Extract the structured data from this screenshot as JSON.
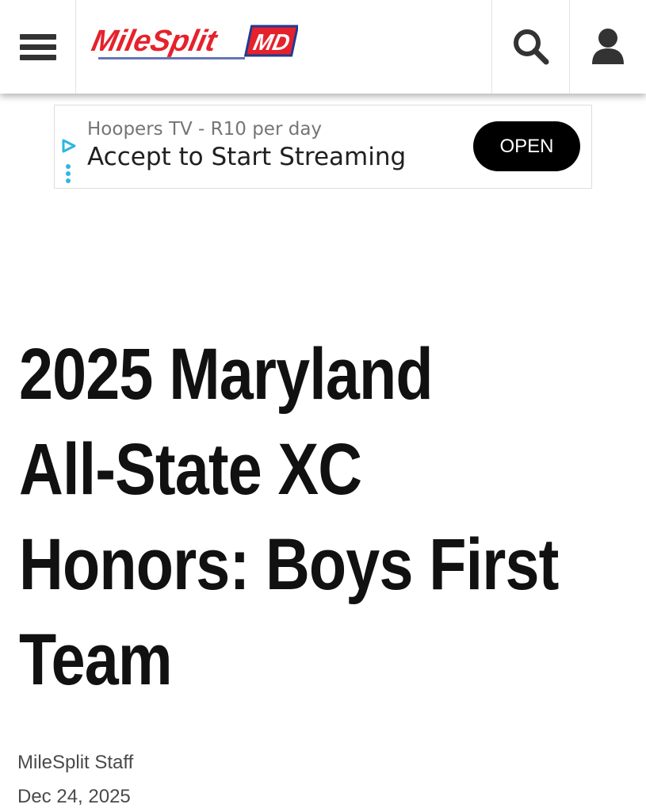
{
  "header": {
    "logo": {
      "name": "MileSplit",
      "state_badge": "MD",
      "colors": {
        "primary_red": "#e5222c",
        "navy": "#1f3a93"
      }
    },
    "icons": {
      "menu": "hamburger-menu-icon",
      "search": "search-icon",
      "account": "user-icon"
    }
  },
  "ad": {
    "sponsor": "Hoopers TV - R10 per day",
    "headline": "Accept to Start Streaming",
    "cta_label": "OPEN",
    "choices_icon": "ad-choices-icon",
    "accent_color": "#2fb5e4"
  },
  "article": {
    "title_lines": [
      "2025 Maryland",
      "All-State XC",
      "Honors: Boys First",
      "Team"
    ],
    "author": "MileSplit Staff",
    "date": "Dec 24, 2025"
  }
}
